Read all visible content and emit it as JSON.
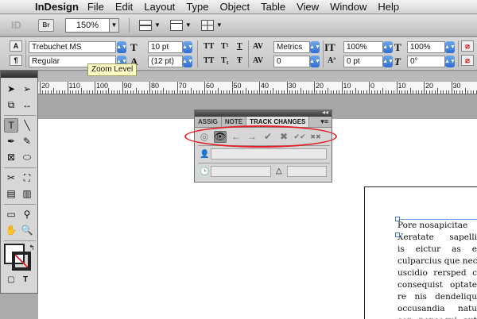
{
  "menubar": {
    "apple_glyph": "",
    "app_name": "InDesign",
    "items": [
      "File",
      "Edit",
      "Layout",
      "Type",
      "Object",
      "Table",
      "View",
      "Window",
      "Help"
    ]
  },
  "appbar": {
    "logo": "ID",
    "bridge_label": "Br",
    "zoom_value": "150%",
    "tooltip": "Zoom Level"
  },
  "control": {
    "font_family": "Trebuchet MS",
    "font_style": "Regular",
    "font_size": "10 pt",
    "leading": "(12 pt)",
    "kerning": "Metrics",
    "tracking": "0",
    "vertical_scale": "100%",
    "baseline_shift": "0 pt",
    "horizontal_scale": "100%",
    "skew": "0°",
    "caps_label": "TT",
    "super_label": "T¹",
    "under_label": "T",
    "sub_label": "T₁",
    "strike_label": "Ŧ"
  },
  "ruler": {
    "labels": [
      "20",
      "110",
      "100",
      "90",
      "80",
      "70",
      "60",
      "50",
      "40",
      "30",
      "20",
      "10",
      "0",
      "10",
      "20",
      "30"
    ]
  },
  "track_changes": {
    "tabs": [
      "ASSIG",
      "NOTE",
      "TRACK CHANGES"
    ],
    "menu_glyph": "▾≡",
    "collapse_glyph": "◂◂",
    "buttons": [
      {
        "name": "enable-tracking",
        "glyph": "◎"
      },
      {
        "name": "show-changes",
        "glyph": "👁"
      },
      {
        "name": "previous-change",
        "glyph": "←"
      },
      {
        "name": "next-change",
        "glyph": "→"
      },
      {
        "name": "accept-change",
        "glyph": "✔"
      },
      {
        "name": "reject-change",
        "glyph": "✖"
      },
      {
        "name": "accept-all",
        "glyph": "✔✔"
      },
      {
        "name": "reject-all",
        "glyph": "✖✖"
      }
    ]
  },
  "document": {
    "lines": [
      "Pore nosapicitae",
      "Xeratate sapelli",
      "is eictur as e",
      "culparcius que nec",
      "uscidio rersped c",
      "consequist optate",
      "re nis dendeliqu",
      "occusandia natu",
      "con ponsequi aut"
    ]
  },
  "colors": {
    "highlight_oval": "#e3202a",
    "spinner": "#2f6ecf",
    "tooltip_bg": "#ffffc6"
  }
}
